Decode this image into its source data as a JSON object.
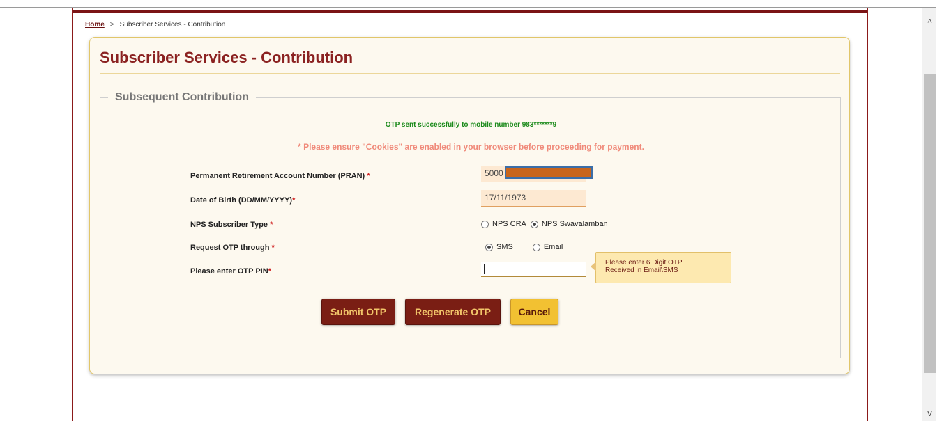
{
  "breadcrumb": {
    "home": "Home",
    "separator": ">",
    "current": "Subscriber Services - Contribution"
  },
  "page": {
    "title": "Subscriber Services - Contribution"
  },
  "section": {
    "legend": "Subsequent Contribution"
  },
  "messages": {
    "otp_sent": "OTP sent successfully to mobile number 983*******9",
    "cookies": "* Please ensure \"Cookies\" are enabled in your browser before proceeding for payment."
  },
  "form": {
    "pran_label": "Permanent Retirement Account Number (PRAN)",
    "pran_value": "5000",
    "dob_label": "Date of Birth (DD/MM/YYYY)",
    "dob_value": "17/11/1973",
    "subscriber_type_label": "NPS Subscriber Type",
    "subscriber_type_options": [
      "NPS CRA",
      "NPS Swavalamban"
    ],
    "subscriber_type_selected": "NPS Swavalamban",
    "otp_through_label": "Request OTP through",
    "otp_through_options": [
      "SMS",
      "Email"
    ],
    "otp_through_selected": "SMS",
    "otp_pin_label": "Please enter OTP PIN",
    "otp_pin_value": "",
    "required_mark": "*"
  },
  "tooltip": {
    "line1": "Please enter 6 Digit OTP",
    "line2": "Received in Email\\SMS"
  },
  "buttons": {
    "submit": "Submit OTP",
    "regenerate": "Regenerate OTP",
    "cancel": "Cancel"
  },
  "scrollbar": {
    "up": "^",
    "down": "v"
  },
  "colors": {
    "brand": "#7a1e14",
    "accent_gold": "#f2c132",
    "title": "#8b2221",
    "success": "#1a8a1a",
    "warning": "#f08a7a"
  }
}
